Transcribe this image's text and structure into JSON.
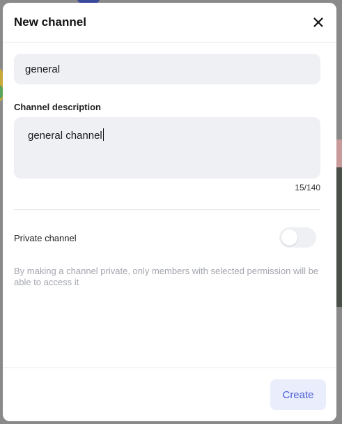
{
  "modal": {
    "title": "New channel",
    "close_icon": "close-icon"
  },
  "channel_name": {
    "value": "general"
  },
  "description": {
    "label": "Channel description",
    "value": "general channel",
    "counter": "15/140"
  },
  "privacy": {
    "label": "Private channel",
    "enabled": false,
    "hint": "By making a channel private, only members with selected permission will be able to access it"
  },
  "footer": {
    "create_label": "Create"
  },
  "colors": {
    "accent": "#4a5fd8",
    "button_bg": "#e9edfc",
    "input_bg": "#eef0f3",
    "hint_text": "#a3a6ae"
  }
}
